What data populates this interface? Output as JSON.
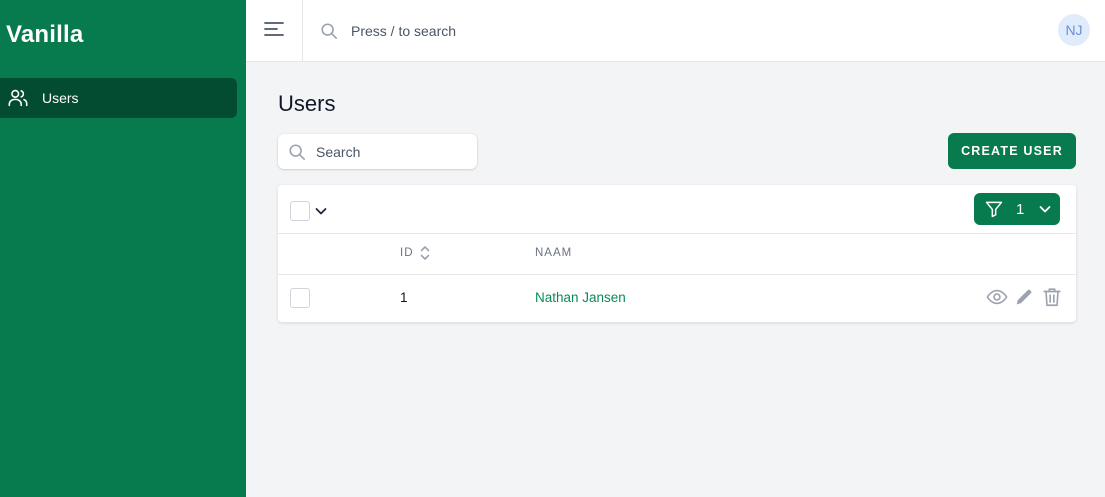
{
  "sidebar": {
    "brand": "Vanilla",
    "items": [
      {
        "label": "Users",
        "icon": "users-icon",
        "active": true
      }
    ]
  },
  "topbar": {
    "search_placeholder": "Press / to search",
    "avatar_initials": "NJ"
  },
  "page": {
    "title": "Users",
    "search_placeholder": "Search",
    "create_button_label": "CREATE USER"
  },
  "table": {
    "filter_count": "1",
    "columns": [
      {
        "key": "id",
        "label": "ID",
        "sortable": true
      },
      {
        "key": "naam",
        "label": "NAAM",
        "sortable": false
      }
    ],
    "rows": [
      {
        "id": "1",
        "naam": "Nathan Jansen"
      }
    ],
    "row_actions": [
      "eye-icon",
      "pencil-icon",
      "trash-icon"
    ]
  },
  "colors": {
    "brand": "#077a4e",
    "sidebar_active": "#034c32",
    "link": "#0b8a57",
    "background": "#f3f4f6"
  }
}
